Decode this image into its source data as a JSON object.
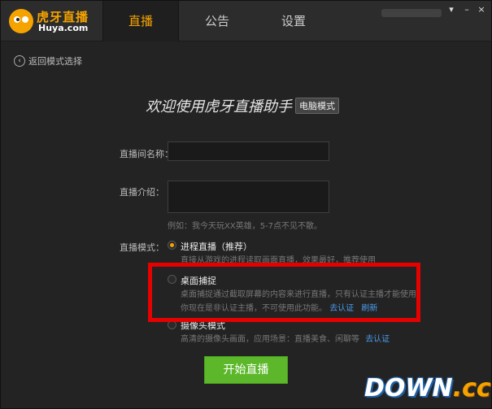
{
  "header": {
    "logo_name": "虎牙直播",
    "logo_domain": "Huya.com",
    "tabs": [
      "直播",
      "公告",
      "设置"
    ],
    "active_tab": 0
  },
  "back": {
    "label": "返回模式选择"
  },
  "welcome": {
    "title": "欢迎使用虎牙直播助手",
    "badge": "电脑模式"
  },
  "form": {
    "room_name_label": "直播间名称：",
    "room_name_value": "",
    "intro_label": "直播介绍：",
    "intro_value": "",
    "intro_hint": "例如：我今天玩XX英雄，5-7点不见不散。",
    "mode_label": "直播模式："
  },
  "modes": [
    {
      "title": "进程直播（推荐）",
      "desc": "直接从游戏的进程读取画面直播，效果最好，推荐使用",
      "selected": true
    },
    {
      "title": "桌面捕捉",
      "desc": "桌面捕捉通过截取屏幕的内容来进行直播，只有认证主播才能使用",
      "desc2": "你现在是非认证主播，不可使用此功能。",
      "link1": "去认证",
      "link2": "刷新",
      "selected": false
    },
    {
      "title": "摄像头模式",
      "desc": "高清的摄像头画面，应用场景：直播美食、闲聊等",
      "link1": "去认证",
      "selected": false
    }
  ],
  "start_button": "开始直播",
  "window_buttons": {
    "menu": "▾",
    "minimize": "–",
    "close": "×"
  },
  "watermark": {
    "main": "DOWN",
    "suffix": ".cc"
  },
  "colors": {
    "accent": "#f5a300",
    "link": "#4b9cf0",
    "start": "#5cb82a",
    "highlight": "#e60000"
  }
}
